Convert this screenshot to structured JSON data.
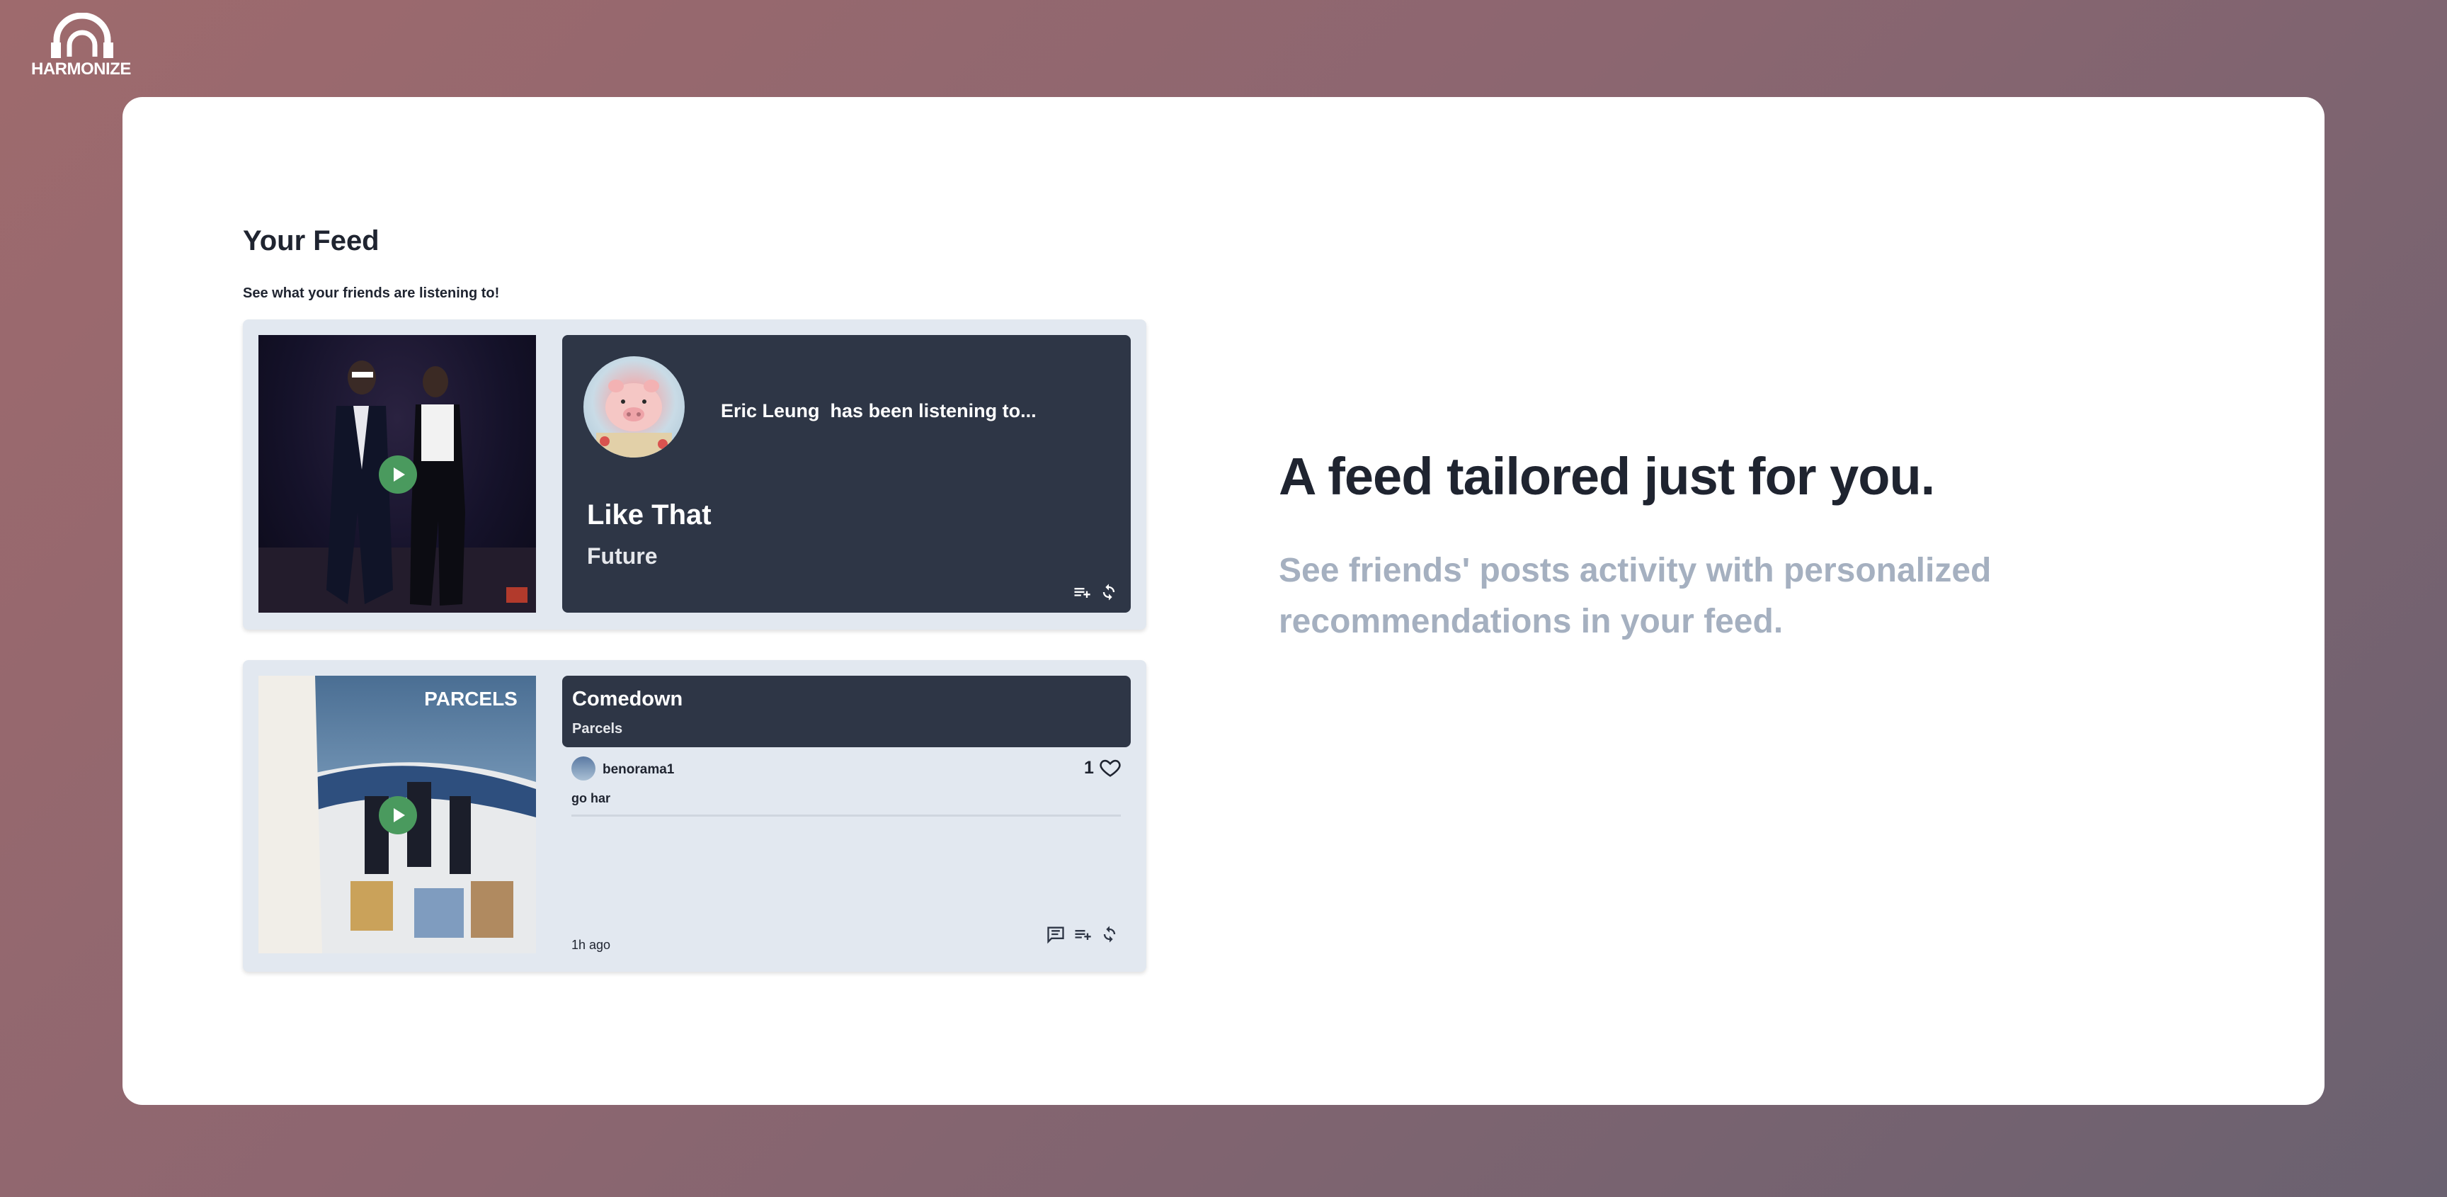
{
  "brand": {
    "name": "HARMONIZE"
  },
  "feed": {
    "title": "Your Feed",
    "subtitle": "See what your friends are listening to!"
  },
  "posts": [
    {
      "friend": "Eric Leung",
      "listening_text": "has been listening to...",
      "song": "Like That",
      "artist": "Future",
      "actions": [
        "add-to-queue-icon",
        "refresh-icon"
      ]
    },
    {
      "song": "Comedown",
      "artist": "Parcels",
      "username": "benorama1",
      "likes": "1",
      "comment": "go har",
      "time_ago": "1h ago",
      "actions": [
        "comment-icon",
        "add-to-queue-icon",
        "refresh-icon"
      ]
    }
  ],
  "hero": {
    "headline": "A feed tailored just for you.",
    "subtext": "See friends' posts activity with personalized recommendations in your feed."
  },
  "colors": {
    "panel": "#ffffff",
    "card": "#e2e8f0",
    "dark_box": "#2e3646",
    "play_button": "#4a9a5e",
    "muted_text": "#a5b0c0"
  }
}
